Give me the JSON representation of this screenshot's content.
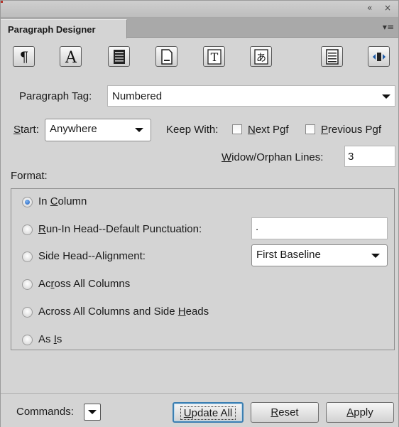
{
  "window": {
    "title_icons": [
      "collapse-icon",
      "close-icon"
    ],
    "collapse_glyph": "«",
    "close_glyph": "×",
    "tab_label": "Paragraph Designer",
    "tab_menu_glyph": "▾≡"
  },
  "toolbar": {
    "icons": [
      "basic-properties-icon",
      "default-font-icon",
      "pagination-icon",
      "numbering-icon",
      "advanced-icon",
      "asian-icon",
      "table-cell-icon",
      "direction-icon"
    ],
    "glyphs": {
      "pilcrow": "¶",
      "letter_a": "A",
      "letter_t": "T",
      "asian": "あ"
    }
  },
  "paragraph_tag": {
    "label": "Paragraph Tag:",
    "value": "Numbered"
  },
  "start": {
    "label_prefix": "S",
    "label_rest": "tart:",
    "value": "Anywhere"
  },
  "keep_with": {
    "label": "Keep With:",
    "next": {
      "prefix": "N",
      "rest": "ext Pgf",
      "checked": false
    },
    "previous": {
      "prefix": "P",
      "rest": "revious Pgf",
      "checked": false
    }
  },
  "widow_orphan": {
    "label_prefix": "W",
    "label_rest": "idow/Orphan Lines:",
    "value": "3"
  },
  "format": {
    "label": "Format:",
    "options": [
      {
        "pre": "In ",
        "u": "C",
        "post": "olumn",
        "selected": true
      },
      {
        "pre": "",
        "u": "R",
        "post": "un-In Head--Default Punctuation:",
        "selected": false
      },
      {
        "pre": "Side Head--Ali",
        "u": "g",
        "post": "nment:",
        "selected": false
      },
      {
        "pre": "Ac",
        "u": "r",
        "post": "oss All Columns",
        "selected": false
      },
      {
        "pre": "Across All Columns and Side ",
        "u": "H",
        "post": "eads",
        "selected": false
      },
      {
        "pre": "As ",
        "u": "I",
        "post": "s",
        "selected": false
      }
    ],
    "punctuation_value": ".",
    "alignment_value": "First Baseline"
  },
  "commands": {
    "label": "Commands:",
    "update_all": {
      "prefix": "U",
      "rest": "pdate All"
    },
    "reset": {
      "prefix": "R",
      "rest": "eset"
    },
    "apply": {
      "prefix": "A",
      "rest": "pply"
    }
  }
}
